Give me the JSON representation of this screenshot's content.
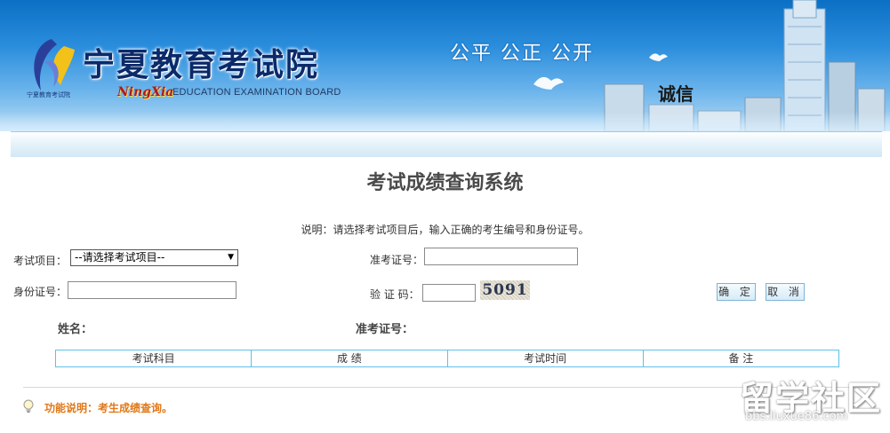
{
  "banner": {
    "org_title": "宁夏教育考试院",
    "logo_small_text": "宁夏教育考试院",
    "cursive": "NingXia",
    "english_name": "EDUCATION EXAMINATION BOARD",
    "slogan": "公平 公正 公开",
    "chengxin": "诚信"
  },
  "page": {
    "title": "考试成绩查询系统",
    "instruction": "说明：请选择考试项目后，输入正确的考生编号和身份证号。"
  },
  "form": {
    "exam_label": "考试项目：",
    "exam_select_value": "--请选择考试项目--",
    "ticket_label": "准考证号：",
    "ticket_value": "",
    "id_label": "身份证号：",
    "id_value": "",
    "captcha_label": "验 证 码：",
    "captcha_value": "",
    "captcha_image_text": "5091",
    "confirm_label": "确 定",
    "cancel_label": "取 消"
  },
  "result": {
    "name_label": "姓名：",
    "ticket_label": "准考证号：",
    "columns": [
      "考试科目",
      "成 绩",
      "考试时间",
      "备 注"
    ]
  },
  "footer": {
    "function_note": "功能说明：考生成绩查询。"
  },
  "watermark": {
    "text": "留学社区",
    "url": "bbs.liuxue86.com"
  },
  "colors": {
    "banner_blue": "#1f7fd2",
    "title_dark": "#0b2a6a",
    "note_orange": "#e07818",
    "table_border": "#5fc0e8"
  }
}
